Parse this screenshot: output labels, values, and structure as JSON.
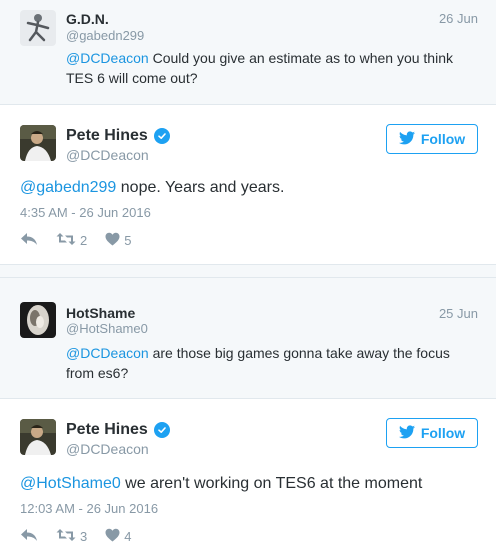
{
  "tweets": [
    {
      "name": "G.D.N.",
      "handle": "@gabedn299",
      "date": "26 Jun",
      "mention": "@DCDeacon",
      "text": " Could you give an estimate as to when you think TES 6 will come out?"
    },
    {
      "name": "Pete Hines",
      "handle": "@DCDeacon",
      "follow_label": "Follow",
      "mention": "@gabedn299",
      "text": " nope. Years and years.",
      "time": "4:35 AM - 26 Jun 2016",
      "retweets": "2",
      "likes": "5"
    },
    {
      "name": "HotShame",
      "handle": "@HotShame0",
      "date": "25 Jun",
      "mention": "@DCDeacon",
      "text": " are those big games gonna take away the focus from es6?"
    },
    {
      "name": "Pete Hines",
      "handle": "@DCDeacon",
      "follow_label": "Follow",
      "mention": "@HotShame0",
      "text": " we aren't working on TES6 at the moment",
      "time": "12:03 AM - 26 Jun 2016",
      "retweets": "3",
      "likes": "4"
    }
  ],
  "icons": {
    "reply": "reply-icon",
    "retweet": "retweet-icon",
    "like": "heart-icon",
    "verified": "verified-badge-icon",
    "twitter": "twitter-bird-icon"
  },
  "colors": {
    "link": "#1b95e0",
    "brand": "#1da1f2",
    "muted": "#8899a6",
    "reply_bg": "#f5f8fa"
  }
}
